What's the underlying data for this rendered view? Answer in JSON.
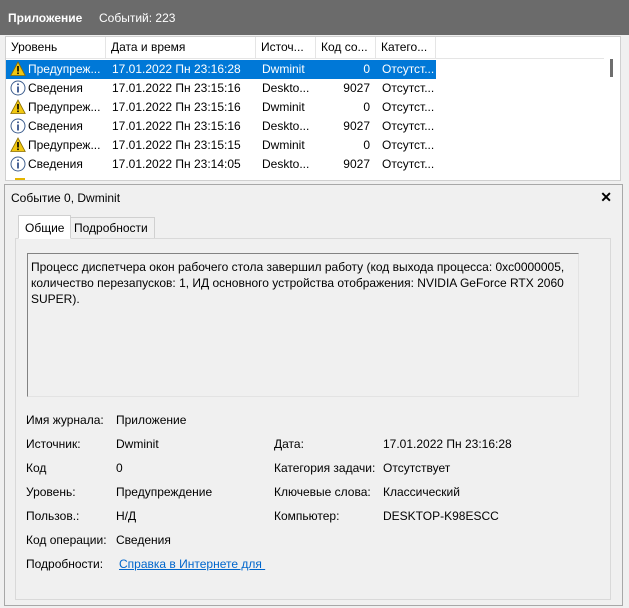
{
  "header": {
    "title": "Приложение",
    "count": "Событий: 223"
  },
  "list": {
    "columns": [
      "Уровень",
      "Дата и время",
      "Источ...",
      "Код со...",
      "Катего..."
    ],
    "rows": [
      {
        "level": "Предупреж...",
        "icon": "warning",
        "date": "17.01.2022 Пн 23:16:28",
        "source": "Dwminit",
        "code": "0",
        "cat": "Отсутст...",
        "selected": true
      },
      {
        "level": "Сведения",
        "icon": "info",
        "date": "17.01.2022 Пн 23:15:16",
        "source": "Deskto...",
        "code": "9027",
        "cat": "Отсутст..."
      },
      {
        "level": "Предупреж...",
        "icon": "warning",
        "date": "17.01.2022 Пн 23:15:16",
        "source": "Dwminit",
        "code": "0",
        "cat": "Отсутст..."
      },
      {
        "level": "Сведения",
        "icon": "info",
        "date": "17.01.2022 Пн 23:15:16",
        "source": "Deskto...",
        "code": "9027",
        "cat": "Отсутст..."
      },
      {
        "level": "Предупреж...",
        "icon": "warning",
        "date": "17.01.2022 Пн 23:15:15",
        "source": "Dwminit",
        "code": "0",
        "cat": "Отсутст..."
      },
      {
        "level": "Сведения",
        "icon": "info",
        "date": "17.01.2022 Пн 23:14:05",
        "source": "Deskto...",
        "code": "9027",
        "cat": "Отсутст..."
      }
    ]
  },
  "detail": {
    "title": "Событие 0, Dwminit",
    "tabs": [
      "Общие",
      "Подробности"
    ],
    "message": "Процесс диспетчера окон рабочего стола завершил работу (код выхода процесса: 0xc0000005, количество перезапусков: 1, ИД основного устройства отображения: NVIDIA GeForce RTX 2060 SUPER).",
    "fields": {
      "log_label": "Имя журнала:",
      "log_value": "Приложение",
      "source_label": "Источник:",
      "source_value": "Dwminit",
      "date_label": "Дата:",
      "date_value": "17.01.2022 Пн 23:16:28",
      "code_label": "Код",
      "code_value": "0",
      "task_label": "Категория задачи:",
      "task_value": "Отсутствует",
      "level_label": "Уровень:",
      "level_value": "Предупреждение",
      "keywords_label": "Ключевые слова:",
      "keywords_value": "Классический",
      "user_label": "Пользов.:",
      "user_value": "Н/Д",
      "computer_label": "Компьютер:",
      "computer_value": "DESKTOP-K98ESCC",
      "opcode_label": "Код операции:",
      "opcode_value": "Сведения",
      "more_label": "Подробности:",
      "more_link": "Справка в Интернете для "
    }
  }
}
